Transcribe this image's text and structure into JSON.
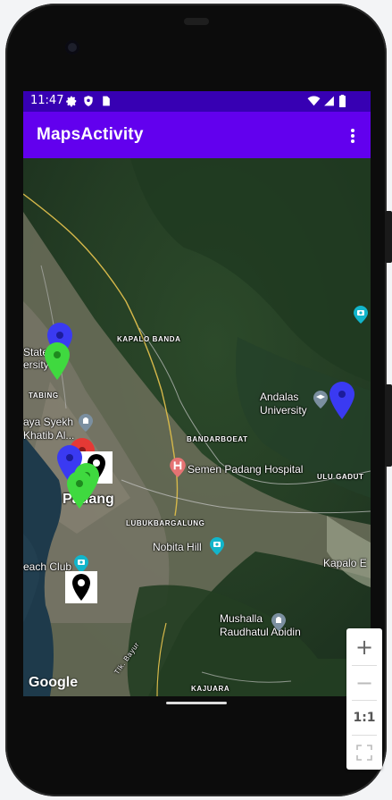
{
  "status_bar": {
    "time": "11:47",
    "icons": [
      "gear-icon",
      "shield-icon",
      "sd-card-icon",
      "wifi-icon",
      "signal-icon",
      "battery-icon"
    ]
  },
  "app_bar": {
    "title": "MapsActivity",
    "overflow_icon": "more-vert-icon"
  },
  "map": {
    "labels": {
      "kapalo_banda": "KAPALO BANDA",
      "state_university": "State\nersity",
      "tabing": "TABING",
      "andalas": "Andalas\nUniversity",
      "raya_syekh": "aya Syekh\nKhatib Al...",
      "bandarbuat": "BANDARBOEAT",
      "hospital": "Semen Padang Hospital",
      "ulu_gadut": "ULU GADUT",
      "padang": "Padang",
      "lubukbargalung": "LUBUKBARGALUNG",
      "nobita": "Nobita Hill",
      "beach_club": "each Club",
      "kapalo_e": "Kapalo E",
      "mushalla": "Mushalla\nRaudhatul Abidin",
      "jl_bayur": "Tlk. Bayur",
      "kajuara": "KAJUARA"
    },
    "attribution": "Google"
  },
  "zoom_controls": {
    "zoom_in": "+",
    "zoom_out": "−",
    "one_to_one": "1:1"
  },
  "colors": {
    "status_bar": "#3700b3",
    "app_bar": "#6200ee",
    "marker_blue": "#3a3af2",
    "marker_green": "#3fd93f",
    "marker_red": "#e53935"
  }
}
